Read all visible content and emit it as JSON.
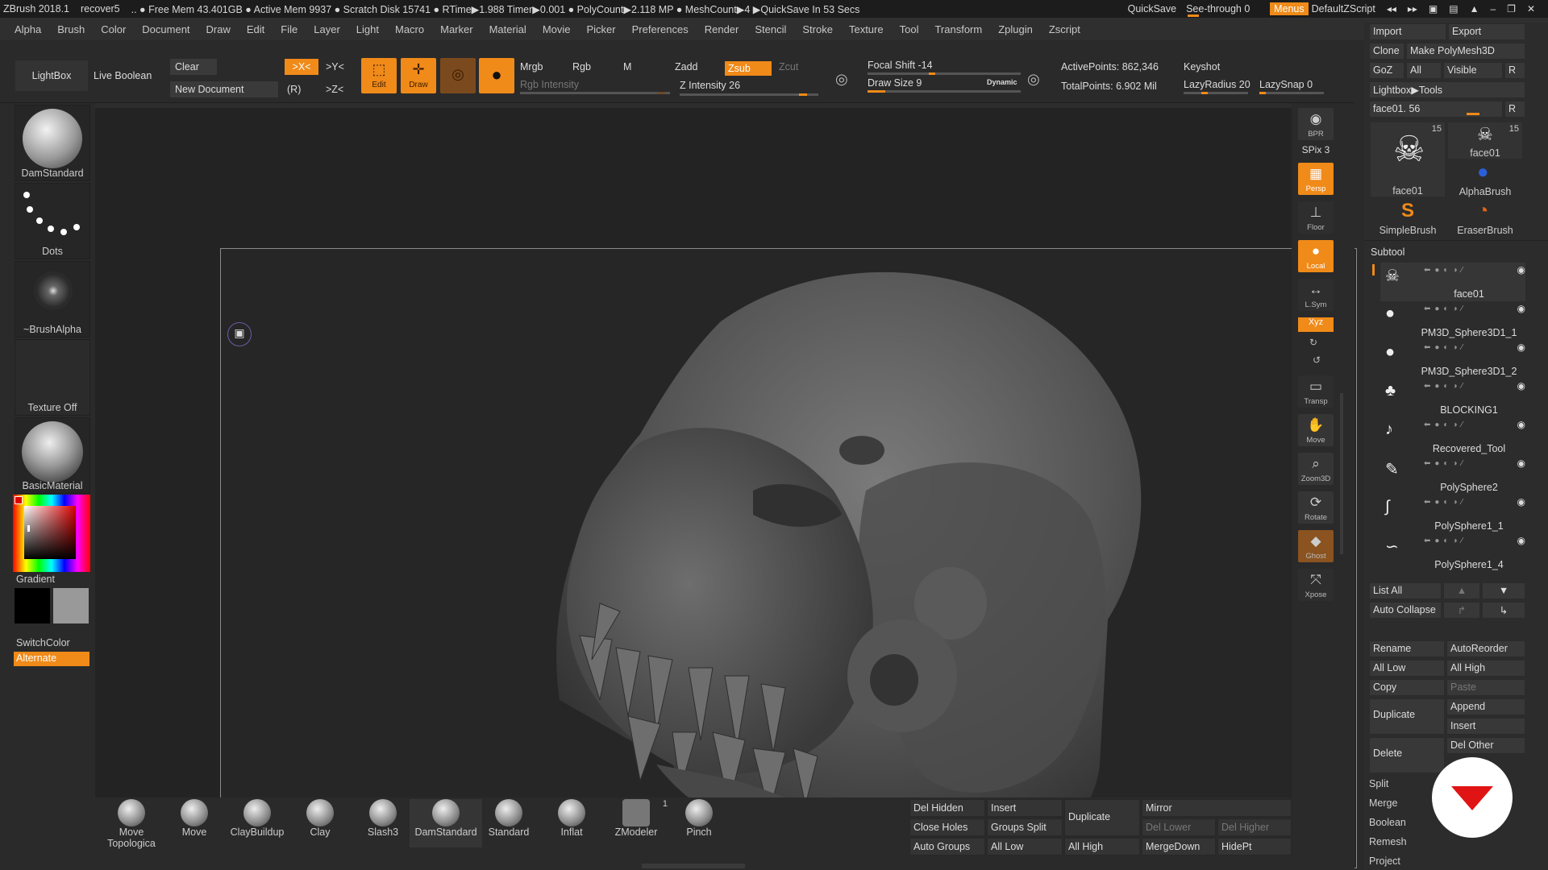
{
  "titlebar": {
    "app": "ZBrush 2018.1",
    "file": "recover5",
    "stats": ".. ● Free Mem 43.401GB ● Active Mem 9937 ● Scratch Disk 15741 ● RTime▶1.988 Timer▶0.001 ● PolyCount▶2.118 MP ● MeshCount▶4 ▶QuickSave In 53 Secs",
    "quicksave": "QuickSave",
    "seethrough": "See-through 0",
    "seethrough_fraction": 0.0,
    "menus": "Menus",
    "script": "DefaultZScript"
  },
  "menubar": [
    "Alpha",
    "Brush",
    "Color",
    "Document",
    "Draw",
    "Edit",
    "File",
    "Layer",
    "Light",
    "Macro",
    "Marker",
    "Material",
    "Movie",
    "Picker",
    "Preferences",
    "Render",
    "Stencil",
    "Stroke",
    "Texture",
    "Tool",
    "Transform",
    "Zplugin",
    "Zscript"
  ],
  "toolbar": {
    "lightbox": "LightBox",
    "live_boolean": "Live Boolean",
    "clear": "Clear",
    "new_document": "New Document",
    "sym_x": ">X<",
    "sym_y": ">Y<",
    "sym_z": ">Z<",
    "sym_r": "(R)",
    "edit": "Edit",
    "draw": "Draw",
    "mrgb": "Mrgb",
    "rgb": "Rgb",
    "m": "M",
    "rgb_intensity": "Rgb Intensity",
    "zadd": "Zadd",
    "zsub": "Zsub",
    "zcut": "Zcut",
    "z_intensity": "Z Intensity 26",
    "z_intensity_value": 26,
    "focal_shift": "Focal Shift -14",
    "draw_size": "Draw Size 9",
    "dynamic": "Dynamic",
    "active_points": "ActivePoints: 862,346",
    "total_points": "TotalPoints: 6.902 Mil",
    "keyshot": "Keyshot",
    "lazy_radius": "LazyRadius 20",
    "lazy_snap": "LazySnap 0"
  },
  "leftpanel": {
    "brush": "DamStandard",
    "stroke": "Dots",
    "alpha": "~BrushAlpha",
    "texture": "Texture Off",
    "material": "BasicMaterial",
    "gradient": "Gradient",
    "switchcolor": "SwitchColor",
    "alternate": "Alternate"
  },
  "bottombar": {
    "brushes": [
      "Move Topologica",
      "Move",
      "ClayBuildup",
      "Clay",
      "Slash3",
      "DamStandard",
      "Standard",
      "Inflat",
      "ZModeler",
      "Pinch"
    ],
    "zmodeler_badge": "1",
    "buttons": {
      "del_hidden": "Del Hidden",
      "insert": "Insert",
      "duplicate": "Duplicate",
      "mirror": "Mirror",
      "close_holes": "Close Holes",
      "groups_split": "Groups Split",
      "del_lower": "Del Lower",
      "del_higher": "Del Higher",
      "auto_groups": "Auto Groups",
      "all_low": "All Low",
      "all_high": "All High",
      "merge_down": "MergeDown",
      "hidept": "HidePt"
    }
  },
  "rightstrip": [
    "BPR",
    "SPix 3",
    "Persp",
    "Floor",
    "Local",
    "L.Sym",
    "Xyz",
    "Transp",
    "Move",
    "Zoom3D",
    "Rotate",
    "Ghost",
    "Xpose"
  ],
  "toolpanel": {
    "import": "Import",
    "export": "Export",
    "clone": "Clone",
    "make_polymesh": "Make PolyMesh3D",
    "goz": "GoZ",
    "all": "All",
    "visible": "Visible",
    "r": "R",
    "lightbox_tools": "Lightbox▶Tools",
    "current_tool": "face01. 56",
    "tools": [
      {
        "name": "face01",
        "count": "15"
      },
      {
        "name": "face01",
        "count": "15"
      },
      {
        "name": "AlphaBrush",
        "count": ""
      },
      {
        "name": "SimpleBrush",
        "count": ""
      },
      {
        "name": "EraserBrush",
        "count": ""
      }
    ],
    "subtool_header": "Subtool",
    "subtools": [
      "face01",
      "PM3D_Sphere3D1_1",
      "PM3D_Sphere3D1_2",
      "BLOCKING1",
      "Recovered_Tool",
      "PolySphere2",
      "PolySphere1_1",
      "PolySphere1_4"
    ],
    "list_all": "List All",
    "auto_collapse": "Auto Collapse",
    "rename": "Rename",
    "autoreorder": "AutoReorder",
    "all_low": "All Low",
    "all_high": "All High",
    "copy": "Copy",
    "paste": "Paste",
    "duplicate": "Duplicate",
    "append": "Append",
    "insert": "Insert",
    "delete": "Delete",
    "del_other": "Del Other",
    "split": "Split",
    "merge": "Merge",
    "boolean": "Boolean",
    "remesh": "Remesh",
    "project": "Project"
  }
}
